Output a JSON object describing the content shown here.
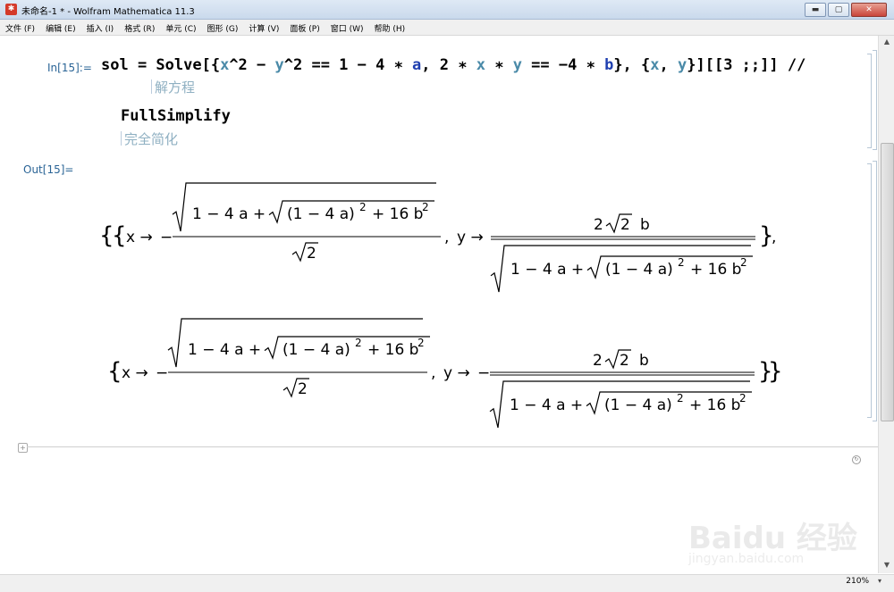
{
  "window": {
    "title": "未命名-1 * - Wolfram Mathematica 11.3",
    "buttons": {
      "minimize": "▬",
      "maximize": "▢",
      "close": "✕"
    }
  },
  "menu": [
    "文件 (F)",
    "编辑 (E)",
    "插入 (I)",
    "格式 (R)",
    "单元 (C)",
    "图形 (G)",
    "计算 (V)",
    "面板 (P)",
    "窗口 (W)",
    "帮助 (H)"
  ],
  "cell_in": {
    "label": "In[15]:=",
    "tokens": [
      {
        "t": "sol = Solve[{",
        "c": ""
      },
      {
        "t": "x",
        "c": "sym-var"
      },
      {
        "t": "^2 − ",
        "c": ""
      },
      {
        "t": "y",
        "c": "sym-var"
      },
      {
        "t": "^2 == 1 − 4 ∗ ",
        "c": ""
      },
      {
        "t": "a",
        "c": "sym-blue"
      },
      {
        "t": ", 2 ∗ ",
        "c": ""
      },
      {
        "t": "x",
        "c": "sym-var"
      },
      {
        "t": " ∗ ",
        "c": ""
      },
      {
        "t": "y",
        "c": "sym-var"
      },
      {
        "t": " == −4 ∗ ",
        "c": ""
      },
      {
        "t": "b",
        "c": "sym-blue"
      },
      {
        "t": "}, {",
        "c": ""
      },
      {
        "t": "x",
        "c": "sym-var"
      },
      {
        "t": ", ",
        "c": ""
      },
      {
        "t": "y",
        "c": "sym-var"
      },
      {
        "t": "}][[3 ;;]] //",
        "c": ""
      }
    ],
    "hint1": "解方程",
    "line2": "FullSimplify",
    "hint2": "完全简化"
  },
  "cell_out": {
    "label": "Out[15]=",
    "inner_radicand": "(1 − 4 a)",
    "exp": "2",
    "term_b": "+ 16 b",
    "outer_prefix": "1 − 4 a +",
    "sqrt2": "2",
    "y_numer": "2",
    "y_b": "b",
    "x_arrow": "x →",
    "y_arrow": "y →",
    "minus": "−",
    "comma": ","
  },
  "status": {
    "zoom": "210%"
  },
  "watermark": {
    "text": "Baidu 经验",
    "url": "jingyan.baidu.com"
  }
}
